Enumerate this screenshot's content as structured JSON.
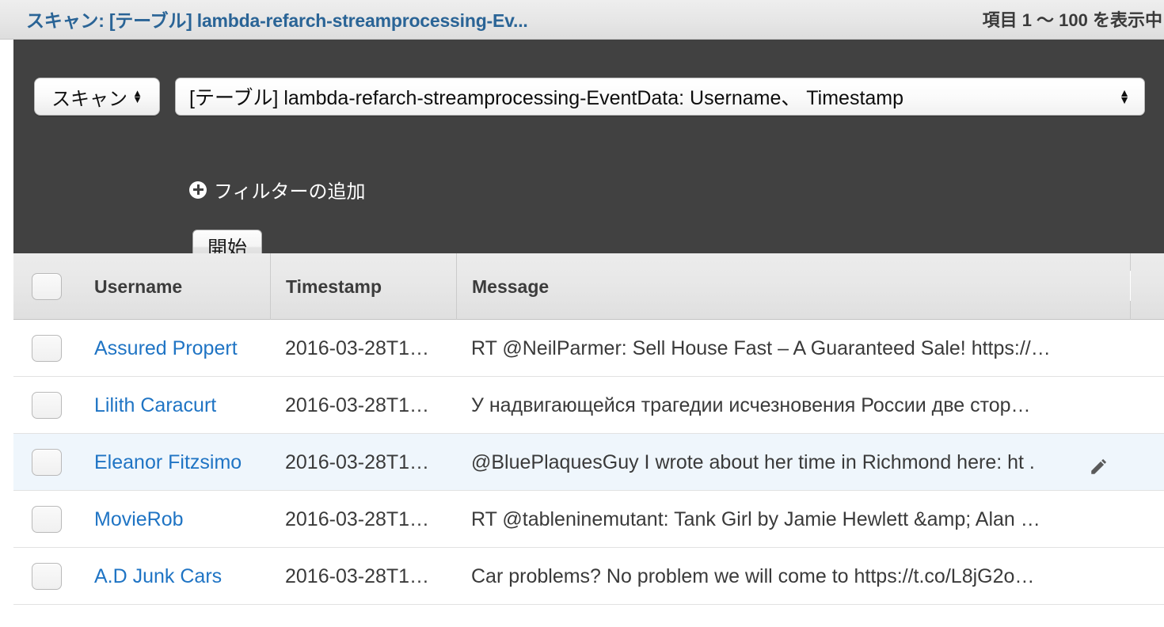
{
  "header": {
    "title": "スキャン: [テーブル] lambda-refarch-streamprocessing-Ev...",
    "item_count": "項目 1 〜 100 を表示中",
    "title_color": "#2a6496"
  },
  "toolbar": {
    "operation_select": {
      "value": "スキャン",
      "icon": "updown-stepper-icon"
    },
    "table_select": {
      "value": "[テーブル] lambda-refarch-streamprocessing-EventData: Username、 Timestamp",
      "icon": "updown-stepper-icon"
    },
    "add_filter": {
      "label": "フィルターの追加",
      "icon": "plus-circle-icon"
    },
    "start_button": "開始",
    "background_color": "#414141"
  },
  "table": {
    "columns": [
      "Username",
      "Timestamp",
      "Message"
    ],
    "rows": [
      {
        "username": "Assured Propert",
        "timestamp": "2016-03-28T1…",
        "message": "RT @NeilParmer: Sell House Fast – A Guaranteed Sale! https://…",
        "hovered": false
      },
      {
        "username": "Lilith Caracurt",
        "timestamp": "2016-03-28T1…",
        "message": "У надвигающейся трагедии исчезновения России две стор…",
        "hovered": false
      },
      {
        "username": "Eleanor Fitzsimo",
        "timestamp": "2016-03-28T1…",
        "message": "@BluePlaquesGuy I wrote about her time in Richmond here: ht .",
        "hovered": true
      },
      {
        "username": "MovieRob",
        "timestamp": "2016-03-28T1…",
        "message": "RT @tableninemutant: Tank Girl by Jamie Hewlett &amp; Alan …",
        "hovered": false
      },
      {
        "username": "A.D Junk Cars",
        "timestamp": "2016-03-28T1…",
        "message": "Car problems? No problem we will come to https://t.co/L8jG2o…",
        "hovered": false
      }
    ],
    "link_color": "#1f74c4",
    "hover_row_color": "#eff6fc",
    "edit_icon": "pencil-icon"
  }
}
